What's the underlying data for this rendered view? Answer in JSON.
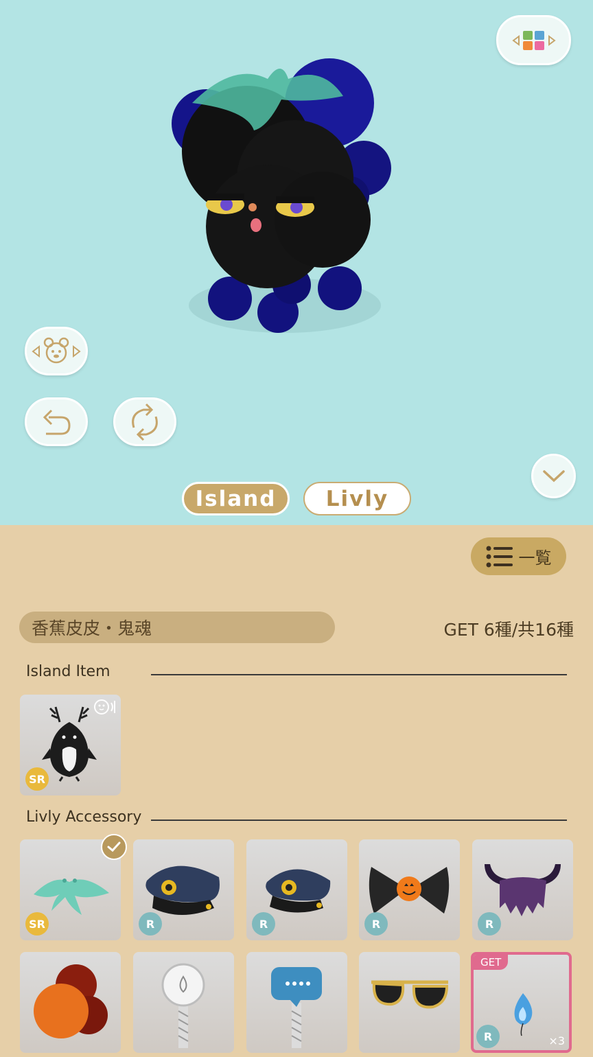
{
  "viewer": {
    "tabs": [
      {
        "label": "Island",
        "active": true
      },
      {
        "label": "Livly",
        "active": false
      }
    ]
  },
  "panel": {
    "list_button_label": "一覧",
    "set_name": "香蕉皮皮・鬼魂",
    "set_count": "GET 6種/共16種",
    "sections": [
      {
        "title": "Island Item"
      },
      {
        "title": "Livly Accessory"
      }
    ],
    "island_items": [
      {
        "rarity": "SR"
      }
    ],
    "accessories": [
      {
        "rarity": "SR",
        "equipped": true
      },
      {
        "rarity": "R"
      },
      {
        "rarity": "R"
      },
      {
        "rarity": "R"
      },
      {
        "rarity": "R"
      },
      {
        "rarity": ""
      },
      {
        "rarity": ""
      },
      {
        "rarity": ""
      },
      {
        "rarity": ""
      },
      {
        "rarity": "R",
        "tag": "GET",
        "quantity": "×3"
      }
    ]
  },
  "colors": {
    "viewer_bg": "#b3e4e4",
    "panel_bg": "#e6cfa8",
    "accent_gold": "#c8a86a",
    "get_pink": "#e06a8e"
  }
}
